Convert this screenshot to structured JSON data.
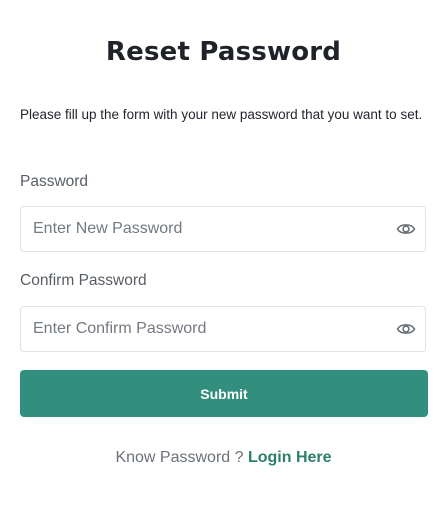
{
  "page": {
    "title": "Reset Password",
    "intro": "Please fill up the form with your new password that you want to set."
  },
  "form": {
    "password": {
      "label": "Password",
      "placeholder": "Enter New Password",
      "value": ""
    },
    "confirm_password": {
      "label": "Confirm Password",
      "placeholder": "Enter Confirm Password",
      "value": ""
    },
    "submit_label": "Submit"
  },
  "footer": {
    "prompt": "Know Password ? ",
    "link_label": "Login Here"
  },
  "icons": {
    "password_toggle": "eye-icon",
    "confirm_toggle": "eye-icon"
  },
  "colors": {
    "accent": "#328e7d",
    "link": "#2f7f6d",
    "label": "#575d65",
    "border": "#dfe2e6"
  }
}
